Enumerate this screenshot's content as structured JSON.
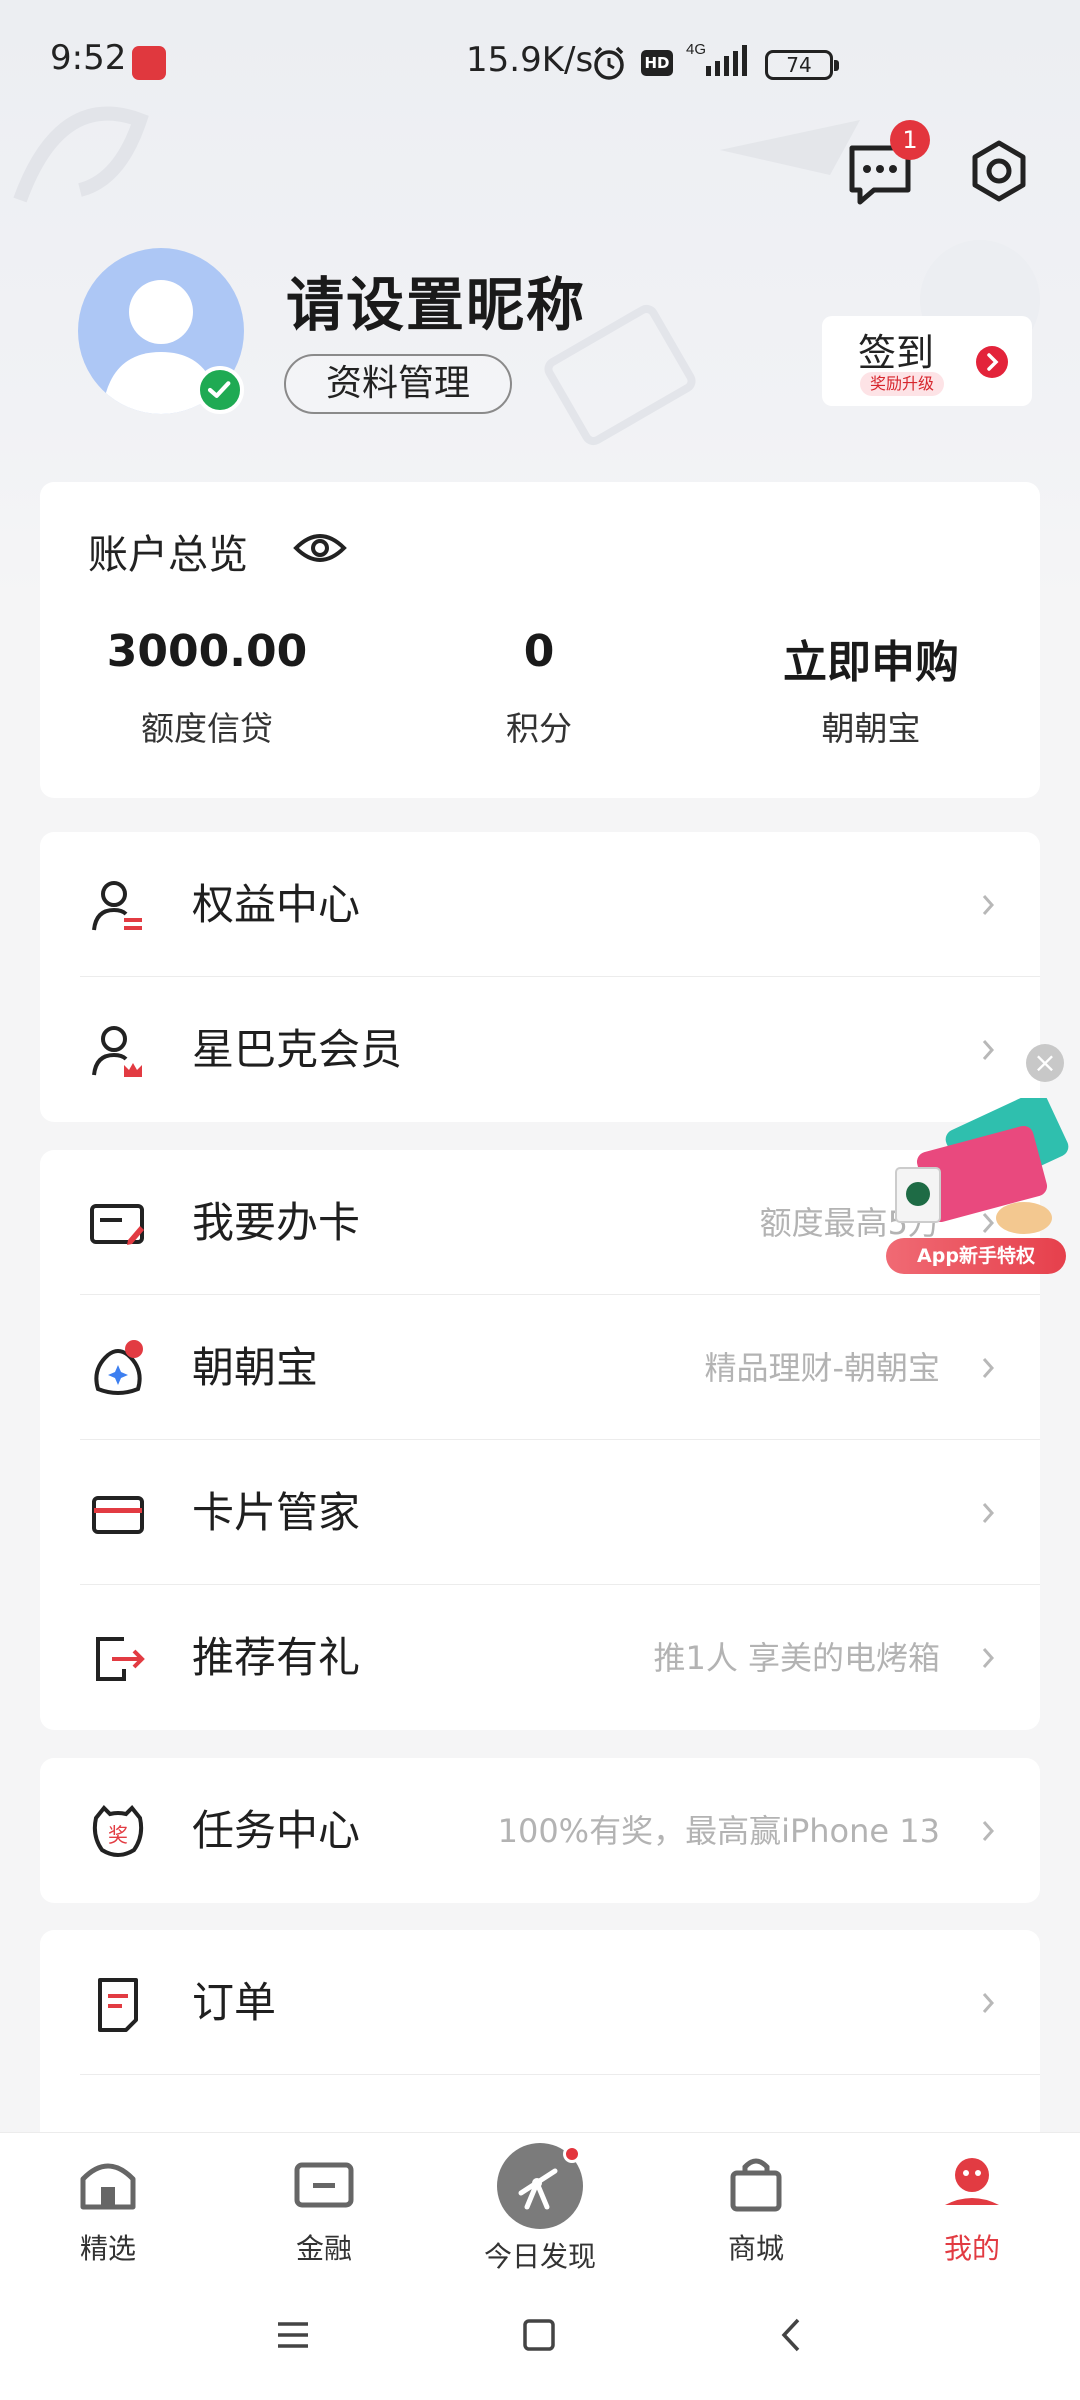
{
  "status_bar": {
    "time": "9:52",
    "speed": "15.9K/s",
    "network": "4G",
    "battery": "74"
  },
  "header": {
    "message_badge": "1",
    "nickname": "请设置昵称",
    "profile_button": "资料管理",
    "signin": {
      "label": "签到",
      "sub": "奖励升级"
    }
  },
  "account": {
    "title": "账户总览",
    "items": [
      {
        "value": "3000.00",
        "label": "额度信贷"
      },
      {
        "value": "0",
        "label": "积分"
      },
      {
        "value": "立即申购",
        "label": "朝朝宝"
      }
    ]
  },
  "group1": [
    {
      "label": "权益中心",
      "hint": ""
    },
    {
      "label": "星巴克会员",
      "hint": ""
    }
  ],
  "group2": [
    {
      "label": "我要办卡",
      "hint": "额度最高5万"
    },
    {
      "label": "朝朝宝",
      "hint": "精品理财-朝朝宝"
    },
    {
      "label": "卡片管家",
      "hint": ""
    },
    {
      "label": "推荐有礼",
      "hint": "推1人 享美的电烤箱"
    }
  ],
  "group3": [
    {
      "label": "任务中心",
      "hint": "100%有奖，最高赢iPhone 13"
    }
  ],
  "group4": [
    {
      "label": "订单",
      "hint": ""
    }
  ],
  "promo": {
    "banner": "App新手特权",
    "close": "×"
  },
  "bottom_nav": [
    {
      "label": "精选"
    },
    {
      "label": "金融"
    },
    {
      "label": "今日发现"
    },
    {
      "label": "商城"
    },
    {
      "label": "我的"
    }
  ],
  "colors": {
    "accent": "#e23b42",
    "check": "#1faa53",
    "avatar_bg": "#adc7f5"
  }
}
